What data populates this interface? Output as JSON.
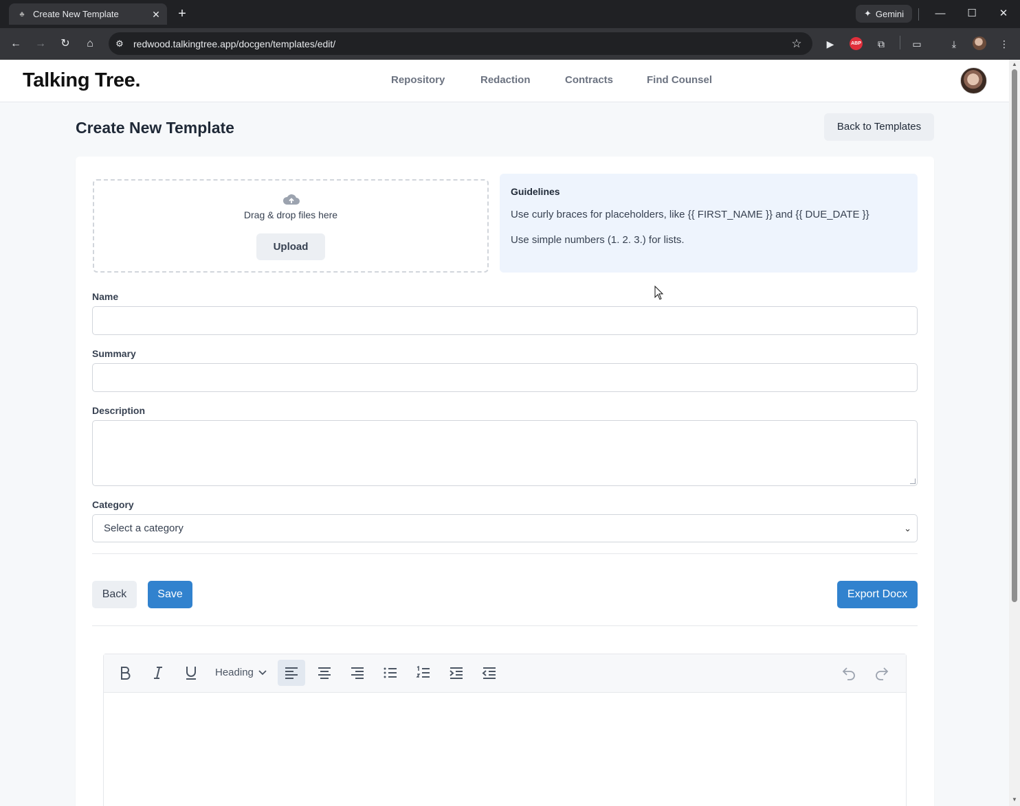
{
  "browser": {
    "tab_title": "Create New Template",
    "url": "redwood.talkingtree.app/docgen/templates/edit/",
    "gemini_label": "Gemini",
    "abp_label": "ABP"
  },
  "header": {
    "brand": "Talking Tree.",
    "nav": [
      "Repository",
      "Redaction",
      "Contracts",
      "Find Counsel"
    ]
  },
  "page": {
    "title": "Create New Template",
    "back_to_templates": "Back to Templates"
  },
  "upload": {
    "drop_text": "Drag & drop files here",
    "upload_label": "Upload"
  },
  "guidelines": {
    "title": "Guidelines",
    "lines": [
      "Use curly braces for placeholders, like {{ FIRST_NAME }} and {{ DUE_DATE }}",
      "Use simple numbers (1. 2. 3.) for lists."
    ]
  },
  "form": {
    "name_label": "Name",
    "name_value": "",
    "summary_label": "Summary",
    "summary_value": "",
    "description_label": "Description",
    "description_value": "",
    "category_label": "Category",
    "category_value": "Select a category"
  },
  "actions": {
    "back": "Back",
    "save": "Save",
    "export": "Export Docx"
  },
  "editor": {
    "heading_label": "Heading",
    "tools": [
      "bold-icon",
      "italic-icon",
      "underline-icon",
      "align-left-icon",
      "align-center-icon",
      "align-right-icon",
      "bullet-list-icon",
      "numbered-list-icon",
      "indent-icon",
      "outdent-icon",
      "undo-icon",
      "redo-icon"
    ],
    "content": ""
  },
  "colors": {
    "primary": "#3182ce",
    "guidelines_bg": "#eef4fd",
    "chrome_dark": "#202124"
  }
}
